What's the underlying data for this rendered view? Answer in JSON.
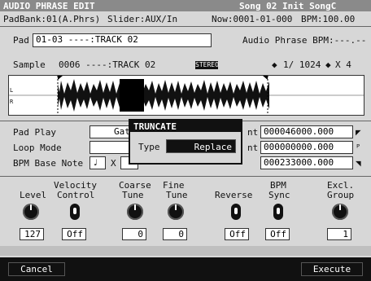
{
  "header": {
    "title": "AUDIO PHRASE EDIT",
    "song": "Song 02 Init SongC",
    "padbank": "PadBank:01(A.Phrs)",
    "slider": "Slider:AUX/In",
    "now": "Now:0001-01-000",
    "bpm": "BPM:100.00"
  },
  "pad": {
    "label": "Pad",
    "value": "01-03 ----:TRACK 02",
    "phrase_bpm": "Audio Phrase BPM:---.--"
  },
  "sample": {
    "label": "Sample",
    "value": "0006 ----:TRACK 02",
    "stereo": "STEREO",
    "zoom_h": "1/ 1024",
    "zoom_v": "X 4"
  },
  "waveform": {
    "channel_l": "L",
    "channel_r": "R"
  },
  "params": {
    "pad_play": "Pad Play",
    "pad_play_value": "Gat",
    "loop_mode": "Loop Mode",
    "bpm_base_note": "BPM Base Note",
    "bpm_base_note_value": "♩",
    "bpm_base_note_mult": "X",
    "start_label": "nt",
    "start_value": "000046000.000",
    "loop_label": "nt",
    "loop_value": "000000000.000",
    "end_value": "000233000.000"
  },
  "dialog": {
    "title": "TRUNCATE",
    "type_label": "Type",
    "type_value": "Replace"
  },
  "controls": {
    "level": {
      "label": "Level",
      "value": "127"
    },
    "velocity": {
      "label1": "Velocity",
      "label2": "Control",
      "value": "Off"
    },
    "coarse": {
      "label1": "Coarse",
      "label2": "Tune",
      "value": "0"
    },
    "fine": {
      "label1": "Fine",
      "label2": "Tune",
      "value": "0"
    },
    "reverse": {
      "label": "Reverse",
      "value": "Off"
    },
    "bpm_sync": {
      "label1": "BPM",
      "label2": "Sync",
      "value": "Off"
    },
    "excl": {
      "label1": "Excl.",
      "label2": "Group",
      "value": "1"
    }
  },
  "footer": {
    "cancel": "Cancel",
    "execute": "Execute"
  }
}
